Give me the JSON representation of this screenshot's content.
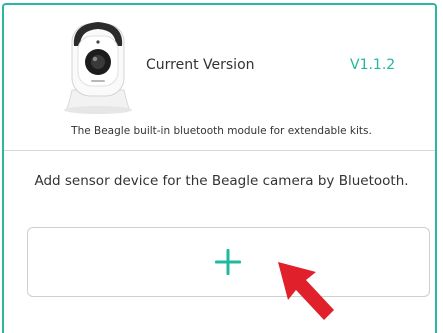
{
  "device": {
    "current_version_label": "Current Version",
    "version_value": "V1.1.2",
    "module_description": "The Beagle built-in bluetooth module for extendable kits."
  },
  "sensor": {
    "add_description": "Add sensor device for the Beagle camera by Bluetooth.",
    "add_button_icon": "plus-icon"
  },
  "colors": {
    "accent": "#20b89e",
    "frame_border": "#2bb5a2",
    "pointer_arrow": "#e0202a"
  }
}
